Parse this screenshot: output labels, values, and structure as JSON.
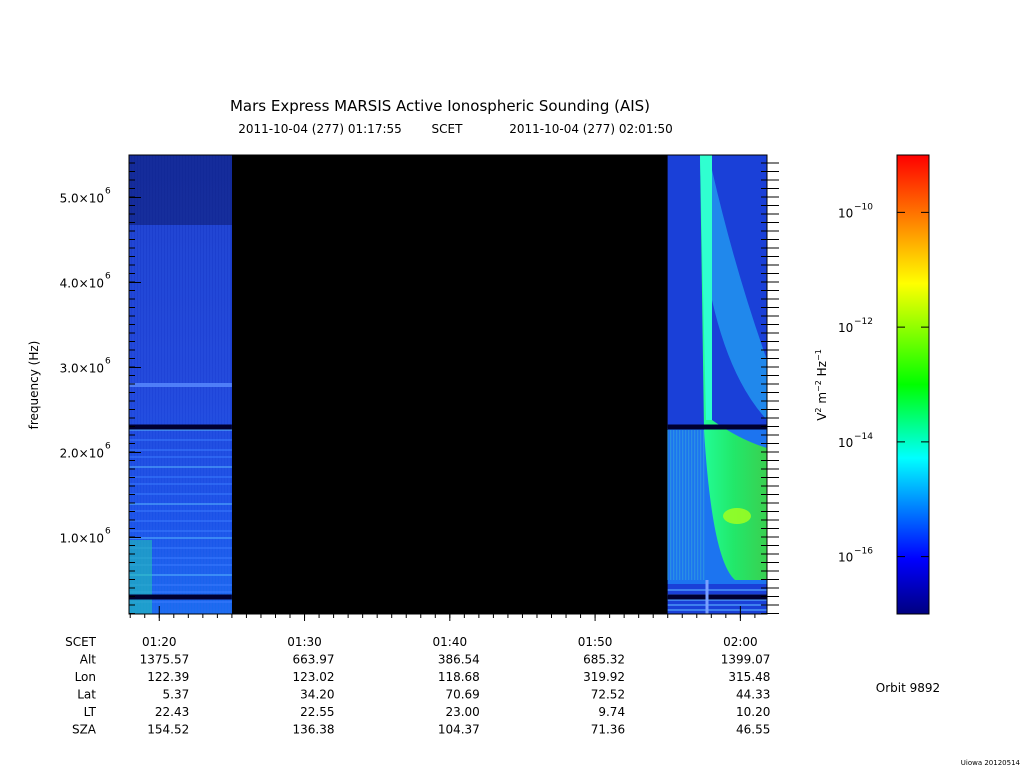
{
  "title": "Mars Express MARSIS Active Ionospheric Sounding (AIS)",
  "time_range": {
    "start": "2011-10-04 (277) 01:17:55",
    "frame": "SCET",
    "end": "2011-10-04 (277) 02:01:50"
  },
  "chart_data": [
    {
      "type": "heatmap",
      "title": "",
      "xlabel": "",
      "ylabel": "frequency (Hz)",
      "xlim": [
        "01:17:55",
        "02:01:50"
      ],
      "ylim": [
        100000,
        5500000
      ],
      "x_ticks": [
        "01:20",
        "01:30",
        "01:40",
        "01:50",
        "02:00"
      ],
      "y_ticks": [
        {
          "value": 1000000,
          "mantissa": "1.0×10",
          "exp": "6"
        },
        {
          "value": 2000000,
          "mantissa": "2.0×10",
          "exp": "6"
        },
        {
          "value": 3000000,
          "mantissa": "3.0×10",
          "exp": "6"
        },
        {
          "value": 4000000,
          "mantissa": "4.0×10",
          "exp": "6"
        },
        {
          "value": 5000000,
          "mantissa": "5.0×10",
          "exp": "6"
        }
      ],
      "data_gap": {
        "start": "01:25:00",
        "end": "01:55:00"
      },
      "data_segments": [
        {
          "start": "01:17:55",
          "end": "01:25:00"
        },
        {
          "start": "01:55:00",
          "end": "02:01:50"
        }
      ],
      "features": [
        {
          "type": "horizontal-line",
          "frequency": 2300000
        },
        {
          "type": "horizontal-line",
          "frequency": 300000
        }
      ],
      "colorbar": {
        "label": "V² m⁻² Hz⁻¹",
        "label_parts": {
          "base": "V",
          "s1": "2",
          "m": "m",
          "s2": "−2",
          "hz": "Hz",
          "s3": "−1"
        },
        "scale": "log",
        "range": [
          1e-17,
          1e-09
        ],
        "ticks": [
          {
            "value": 1e-10,
            "base": "10",
            "exp": "−10"
          },
          {
            "value": 1e-12,
            "base": "10",
            "exp": "−12"
          },
          {
            "value": 1e-14,
            "base": "10",
            "exp": "−14"
          },
          {
            "value": 1e-16,
            "base": "10",
            "exp": "−16"
          }
        ],
        "colormap": [
          "#000080",
          "#0000ff",
          "#00ffff",
          "#00ff00",
          "#ffff00",
          "#ff8000",
          "#ff0000"
        ]
      }
    }
  ],
  "ephemeris": {
    "row_labels": [
      "SCET",
      "Alt",
      "Lon",
      "Lat",
      "LT",
      "SZA"
    ],
    "columns": [
      {
        "SCET": "01:20",
        "Alt": "1375.57",
        "Lon": "122.39",
        "Lat": "5.37",
        "LT": "22.43",
        "SZA": "154.52"
      },
      {
        "SCET": "01:30",
        "Alt": "663.97",
        "Lon": "123.02",
        "Lat": "34.20",
        "LT": "22.55",
        "SZA": "136.38"
      },
      {
        "SCET": "01:40",
        "Alt": "386.54",
        "Lon": "118.68",
        "Lat": "70.69",
        "LT": "23.00",
        "SZA": "104.37"
      },
      {
        "SCET": "01:50",
        "Alt": "685.32",
        "Lon": "319.92",
        "Lat": "72.52",
        "LT": "9.74",
        "SZA": "71.36"
      },
      {
        "SCET": "02:00",
        "Alt": "1399.07",
        "Lon": "315.48",
        "Lat": "44.33",
        "LT": "10.20",
        "SZA": "46.55"
      }
    ]
  },
  "orbit_label": "Orbit 9892",
  "footer": "Uiowa 20120514"
}
